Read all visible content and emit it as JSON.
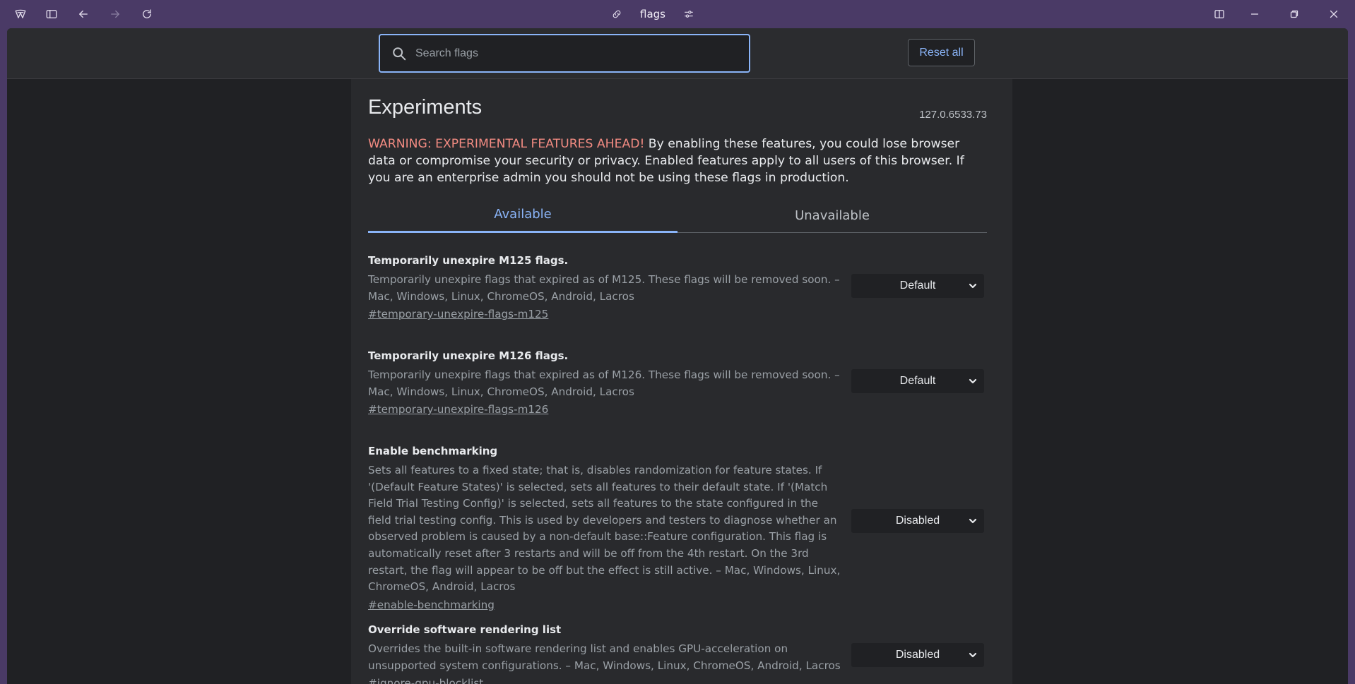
{
  "titlebar": {
    "address_text": "flags",
    "icons": [
      "logo-icon",
      "sidebar-toggle-icon",
      "back-icon",
      "forward-icon",
      "reload-icon",
      "link-icon",
      "page-settings-icon",
      "split-view-icon",
      "minimize-icon",
      "restore-icon",
      "close-icon"
    ]
  },
  "toolbar": {
    "search_placeholder": "Search flags",
    "reset_label": "Reset all"
  },
  "page": {
    "title": "Experiments",
    "version": "127.0.6533.73",
    "warning_strong": "WARNING: EXPERIMENTAL FEATURES AHEAD!",
    "warning_text": " By enabling these features, you could lose browser data or compromise your security or privacy. Enabled features apply to all users of this browser. If you are an enterprise admin you should not be using these flags in production.",
    "tabs": [
      {
        "label": "Available",
        "active": true
      },
      {
        "label": "Unavailable",
        "active": false
      }
    ]
  },
  "flags": [
    {
      "name": "Temporarily unexpire M125 flags.",
      "description": "Temporarily unexpire flags that expired as of M125. These flags will be removed soon. – Mac, Windows, Linux, ChromeOS, Android, Lacros",
      "link": "#temporary-unexpire-flags-m125",
      "value": "Default"
    },
    {
      "name": "Temporarily unexpire M126 flags.",
      "description": "Temporarily unexpire flags that expired as of M126. These flags will be removed soon. – Mac, Windows, Linux, ChromeOS, Android, Lacros",
      "link": "#temporary-unexpire-flags-m126",
      "value": "Default"
    },
    {
      "name": "Enable benchmarking",
      "description": "Sets all features to a fixed state; that is, disables randomization for feature states. If '(Default Feature States)' is selected, sets all features to their default state. If '(Match Field Trial Testing Config)' is selected, sets all features to the state configured in the field trial testing config. This is used by developers and testers to diagnose whether an observed problem is caused by a non-default base::Feature configuration. This flag is automatically reset after 3 restarts and will be off from the 4th restart. On the 3rd restart, the flag will appear to be off but the effect is still active. – Mac, Windows, Linux, ChromeOS, Android, Lacros",
      "link": "#enable-benchmarking",
      "value": "Disabled"
    },
    {
      "name": "Override software rendering list",
      "description": "Overrides the built-in software rendering list and enables GPU-acceleration on unsupported system configurations. – Mac, Windows, Linux, ChromeOS, Android, Lacros",
      "link": "#ignore-gpu-blocklist",
      "value": "Disabled"
    }
  ]
}
